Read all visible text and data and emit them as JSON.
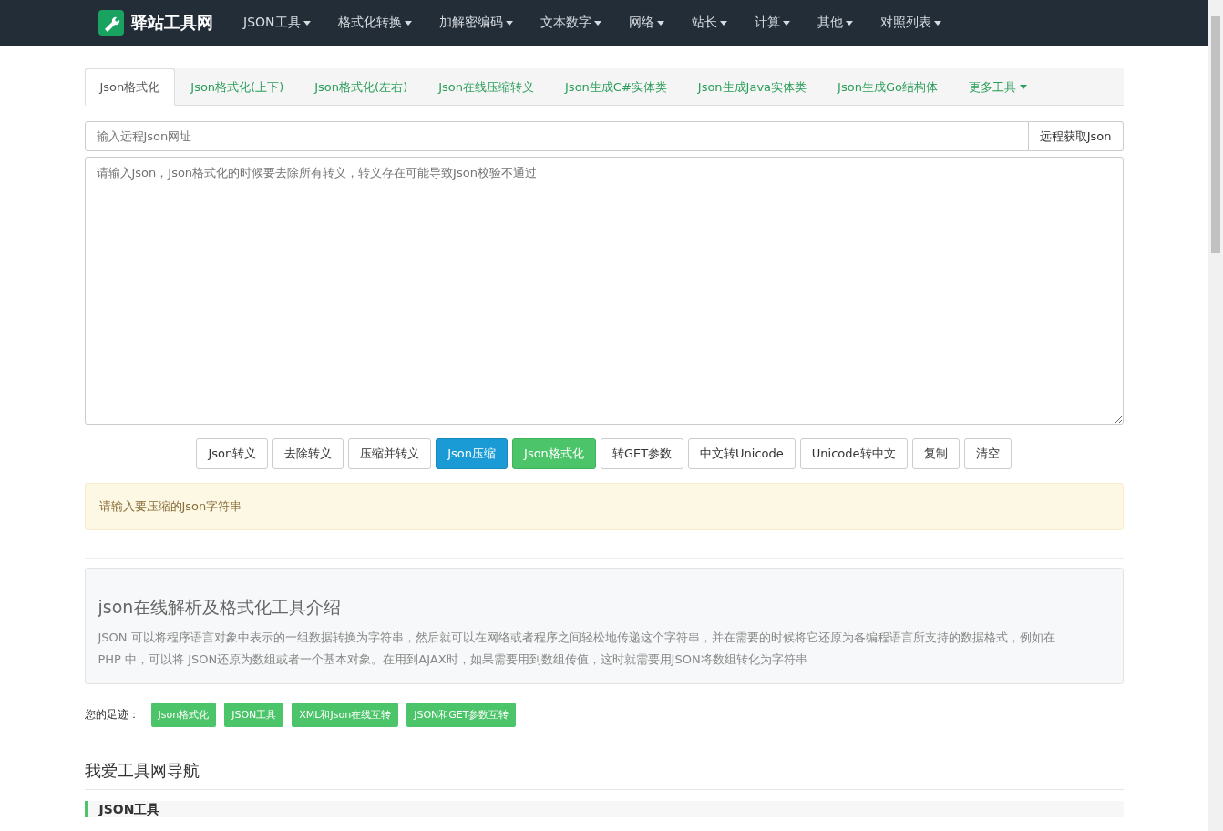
{
  "navbar": {
    "brand": "驿站工具网",
    "menus": [
      "JSON工具",
      "格式化转换",
      "加解密编码",
      "文本数字",
      "网络",
      "站长",
      "计算",
      "其他",
      "对照列表"
    ]
  },
  "tabs": [
    {
      "label": "Json格式化",
      "selected": true,
      "dropdown": false
    },
    {
      "label": "Json格式化(上下)",
      "selected": false,
      "dropdown": false
    },
    {
      "label": "Json格式化(左右)",
      "selected": false,
      "dropdown": false
    },
    {
      "label": "Json在线压缩转义",
      "selected": false,
      "dropdown": false
    },
    {
      "label": "Json生成C#实体类",
      "selected": false,
      "dropdown": false
    },
    {
      "label": "Json生成Java实体类",
      "selected": false,
      "dropdown": false
    },
    {
      "label": "Json生成Go结构体",
      "selected": false,
      "dropdown": false
    },
    {
      "label": "更多工具",
      "selected": false,
      "dropdown": true
    }
  ],
  "url_field": {
    "placeholder": "输入远程Json网址",
    "button": "远程获取Json"
  },
  "editor": {
    "placeholder": "请输入Json，Json格式化的时候要去除所有转义，转义存在可能导致Json校验不通过"
  },
  "actions": [
    {
      "label": "Json转义",
      "kind": "default"
    },
    {
      "label": "去除转义",
      "kind": "default"
    },
    {
      "label": "压缩并转义",
      "kind": "default"
    },
    {
      "label": "Json压缩",
      "kind": "primary"
    },
    {
      "label": "Json格式化",
      "kind": "success"
    },
    {
      "label": "转GET参数",
      "kind": "default"
    },
    {
      "label": "中文转Unicode",
      "kind": "default"
    },
    {
      "label": "Unicode转中文",
      "kind": "default"
    },
    {
      "label": "复制",
      "kind": "default"
    },
    {
      "label": "清空",
      "kind": "default"
    }
  ],
  "alert": "请输入要压缩的Json字符串",
  "intro": {
    "title": "json在线解析及格式化工具介绍",
    "text": "JSON 可以将程序语言对象中表示的一组数据转换为字符串，然后就可以在网络或者程序之间轻松地传递这个字符串，并在需要的时候将它还原为各编程语言所支持的数据格式，例如在 PHP 中，可以将 JSON还原为数组或者一个基本对象。在用到AJAX时，如果需要用到数组传值，这时就需要用JSON将数组转化为字符串"
  },
  "footprints": {
    "label": "您的足迹：",
    "tags": [
      "Json格式化",
      "JSON工具",
      "XML和Json在线互转",
      "JSON和GET参数互转"
    ]
  },
  "nav_section": {
    "title": "我爱工具网导航",
    "group": "JSON工具"
  }
}
